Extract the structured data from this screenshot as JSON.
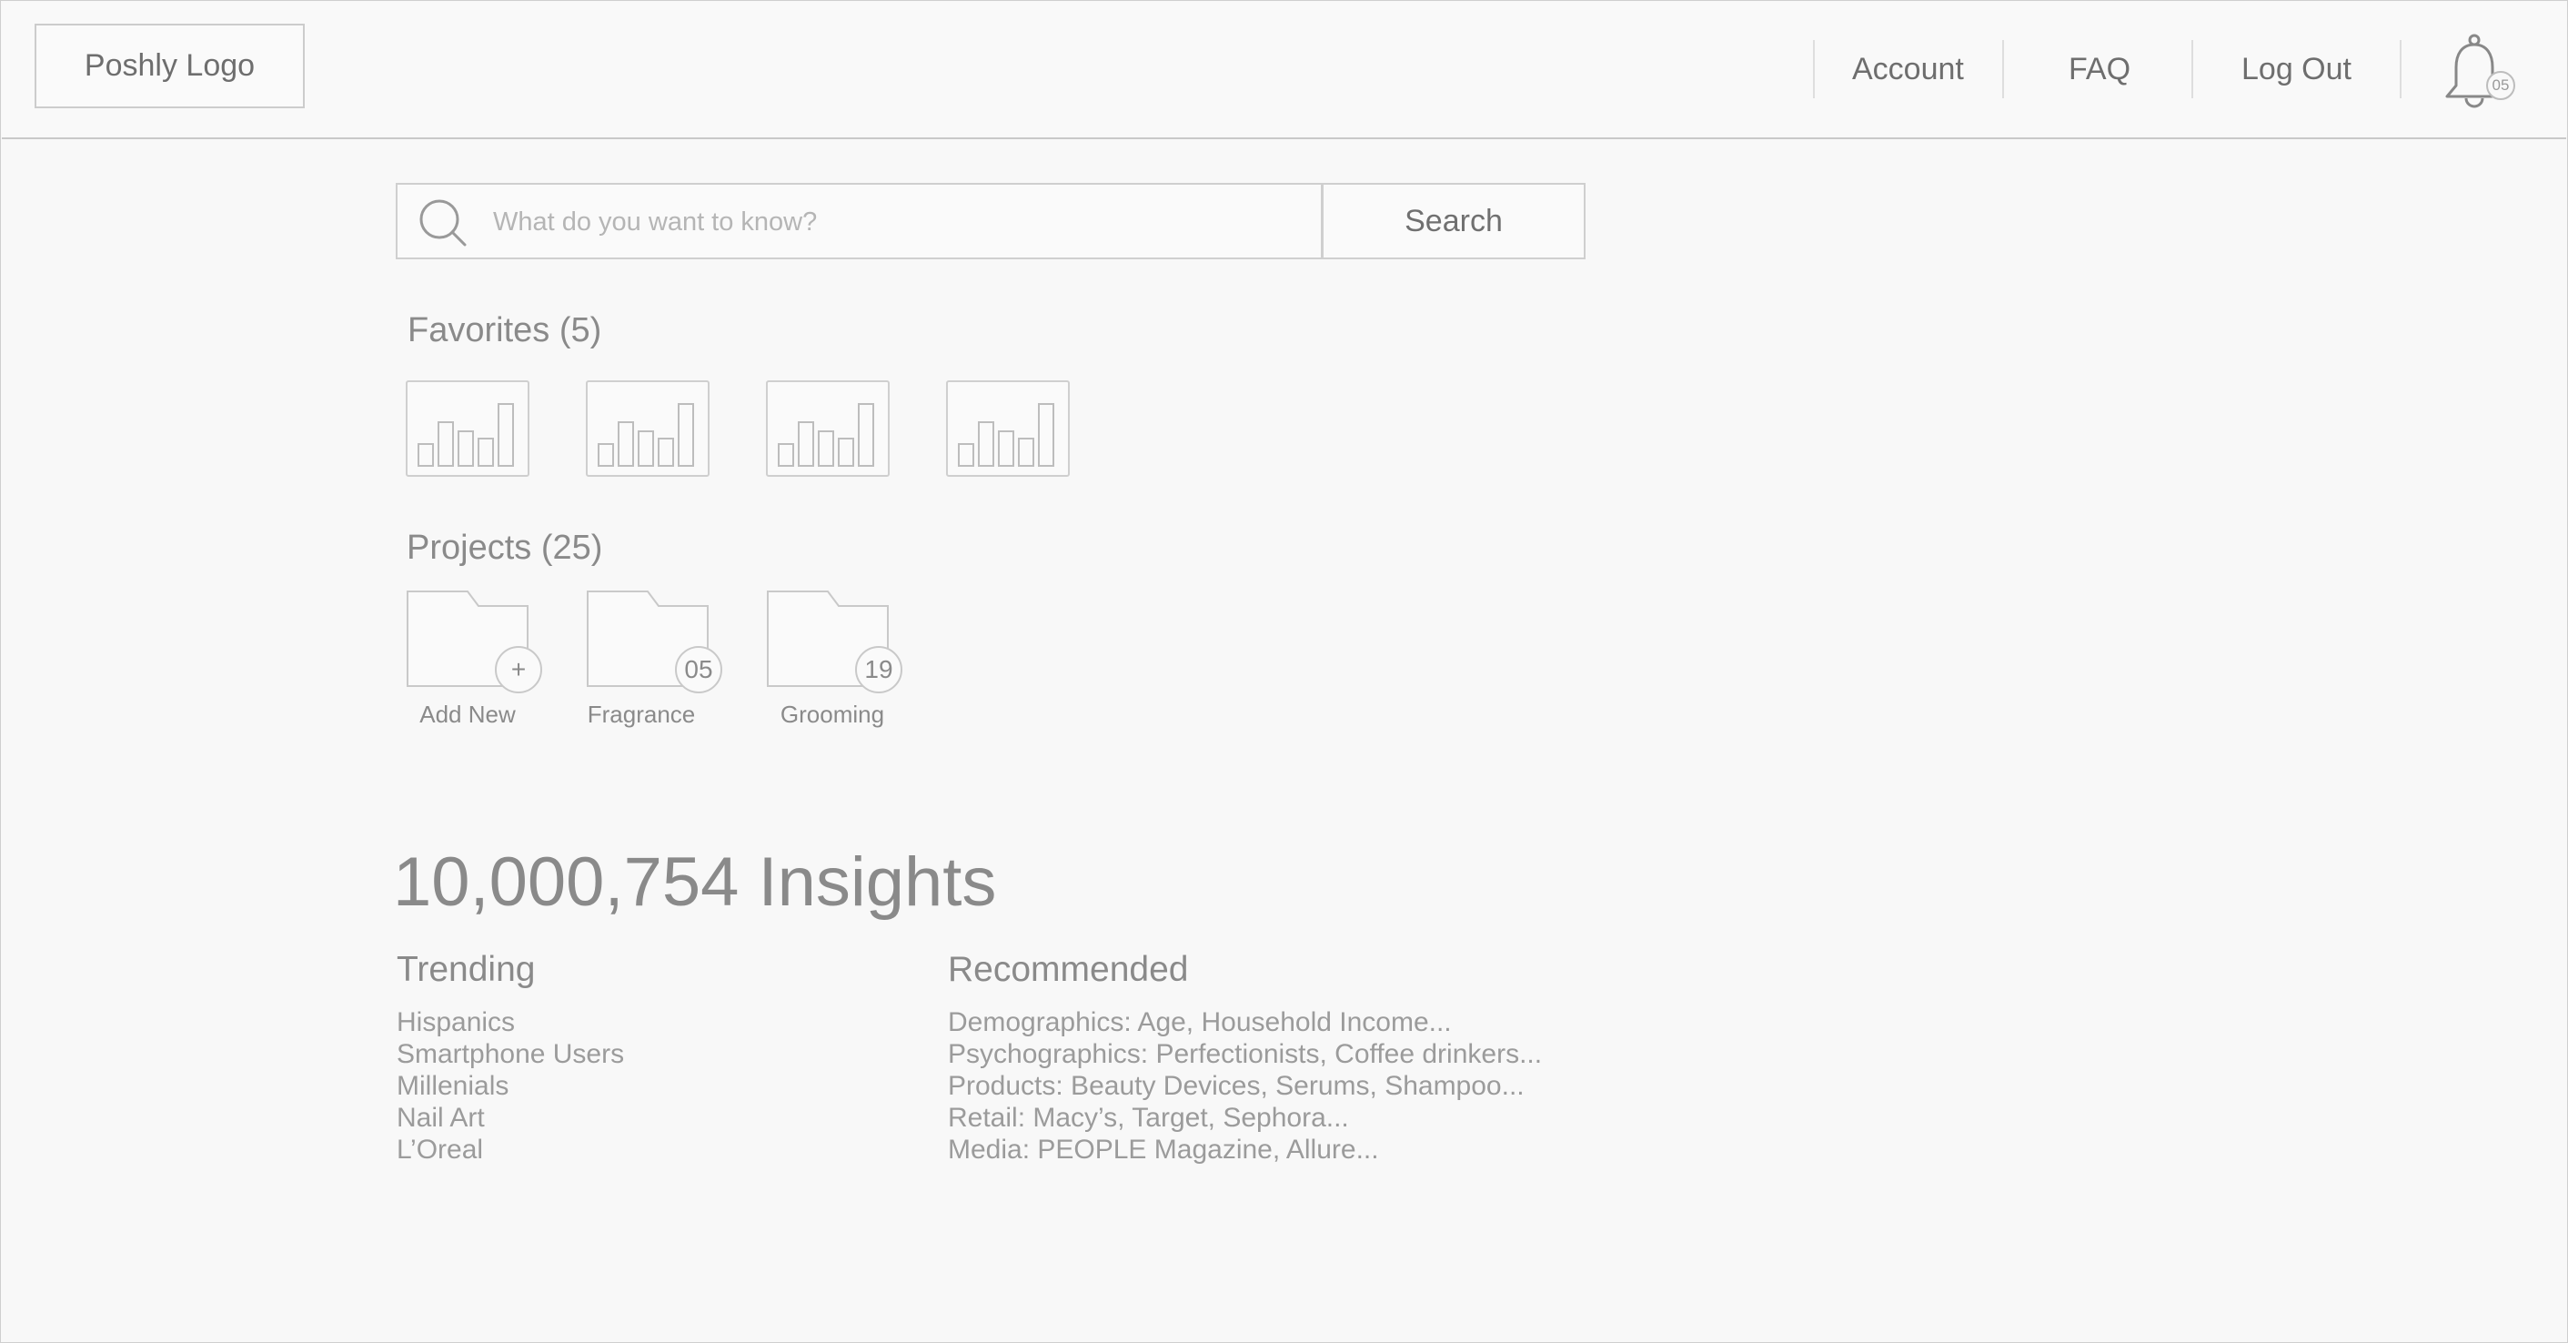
{
  "header": {
    "logo": "Poshly Logo",
    "nav": [
      {
        "label": "Account"
      },
      {
        "label": "FAQ"
      },
      {
        "label": "Log Out"
      }
    ],
    "notifications_count": "05"
  },
  "search": {
    "placeholder": "What do you want to know?",
    "button": "Search"
  },
  "favorites": {
    "title": "Favorites (5)",
    "items": [
      {
        "icon": "bar-chart-icon"
      },
      {
        "icon": "bar-chart-icon"
      },
      {
        "icon": "bar-chart-icon"
      },
      {
        "icon": "bar-chart-icon"
      }
    ]
  },
  "projects": {
    "title": "Projects (25)",
    "items": [
      {
        "label": "Add New",
        "badge": "+",
        "icon": "folder-icon"
      },
      {
        "label": "Fragrance",
        "badge": "05",
        "icon": "folder-icon"
      },
      {
        "label": "Grooming",
        "badge": "19",
        "icon": "folder-icon"
      }
    ]
  },
  "insights": {
    "headline": "10,000,754 Insights",
    "trending": {
      "title": "Trending",
      "items": [
        "Hispanics",
        "Smartphone Users",
        "Millenials",
        "Nail Art",
        "L’Oreal"
      ]
    },
    "recommended": {
      "title": "Recommended",
      "items": [
        "Demographics: Age, Household Income...",
        "Psychographics: Perfectionists, Coffee drinkers...",
        "Products: Beauty Devices, Serums, Shampoo...",
        "Retail: Macy’s, Target, Sephora...",
        "Media: PEOPLE Magazine, Allure..."
      ]
    }
  },
  "colors": {
    "background": "#f8f8f8",
    "border": "#cfcfcf",
    "text": "#8a8a8a"
  }
}
